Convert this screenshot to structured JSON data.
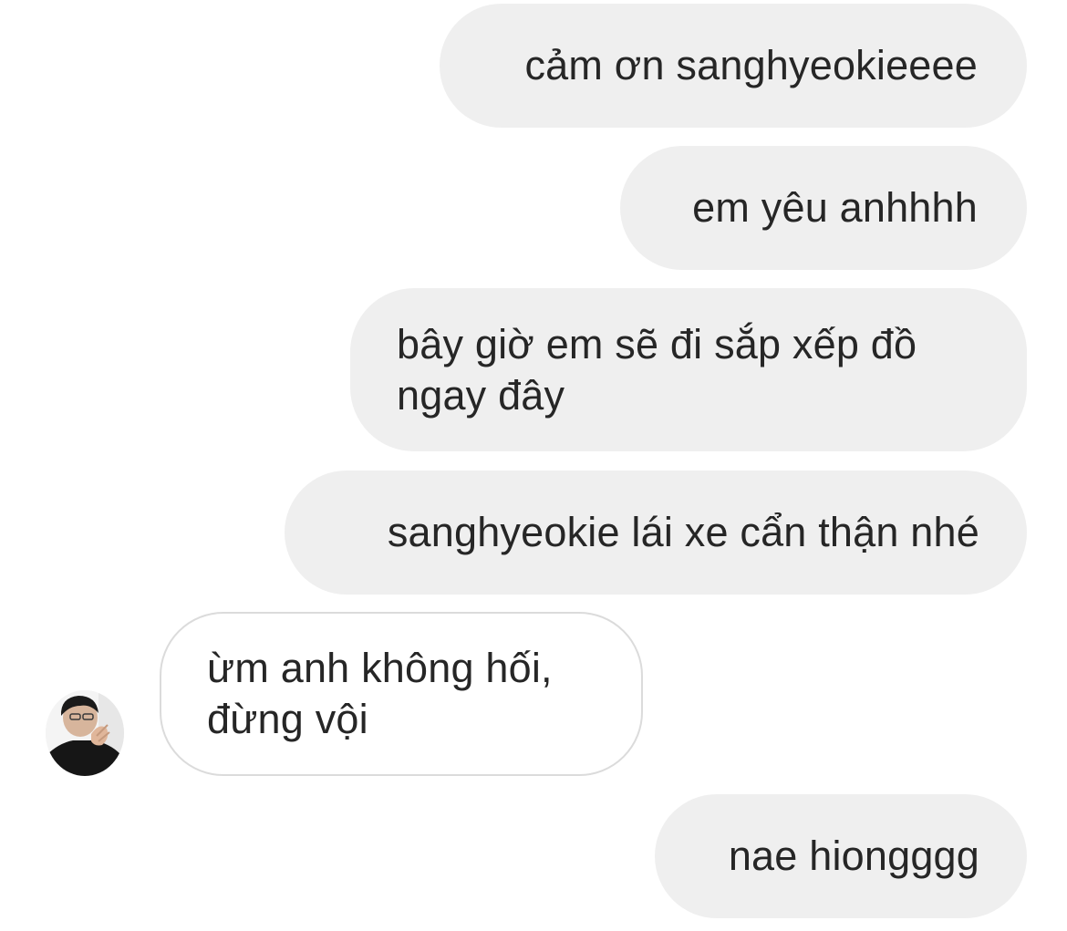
{
  "conversation": {
    "messages": [
      {
        "sender": "me",
        "text": "cảm ơn sanghyeokieeee"
      },
      {
        "sender": "me",
        "text": "em yêu anhhhh"
      },
      {
        "sender": "me",
        "text": "bây giờ em sẽ đi sắp xếp đồ ngay đây"
      },
      {
        "sender": "me",
        "text": "sanghyeokie lái xe cẩn thận nhé"
      },
      {
        "sender": "other",
        "text": "ừm anh không hối, đừng vội"
      },
      {
        "sender": "me",
        "text": "nae hiongggg"
      }
    ],
    "colors": {
      "sent_bubble": "#efefef",
      "received_bubble": "#ffffff",
      "received_border": "#dbdbdb",
      "text": "#262626"
    },
    "icons": {
      "avatar": "profile-photo"
    }
  }
}
